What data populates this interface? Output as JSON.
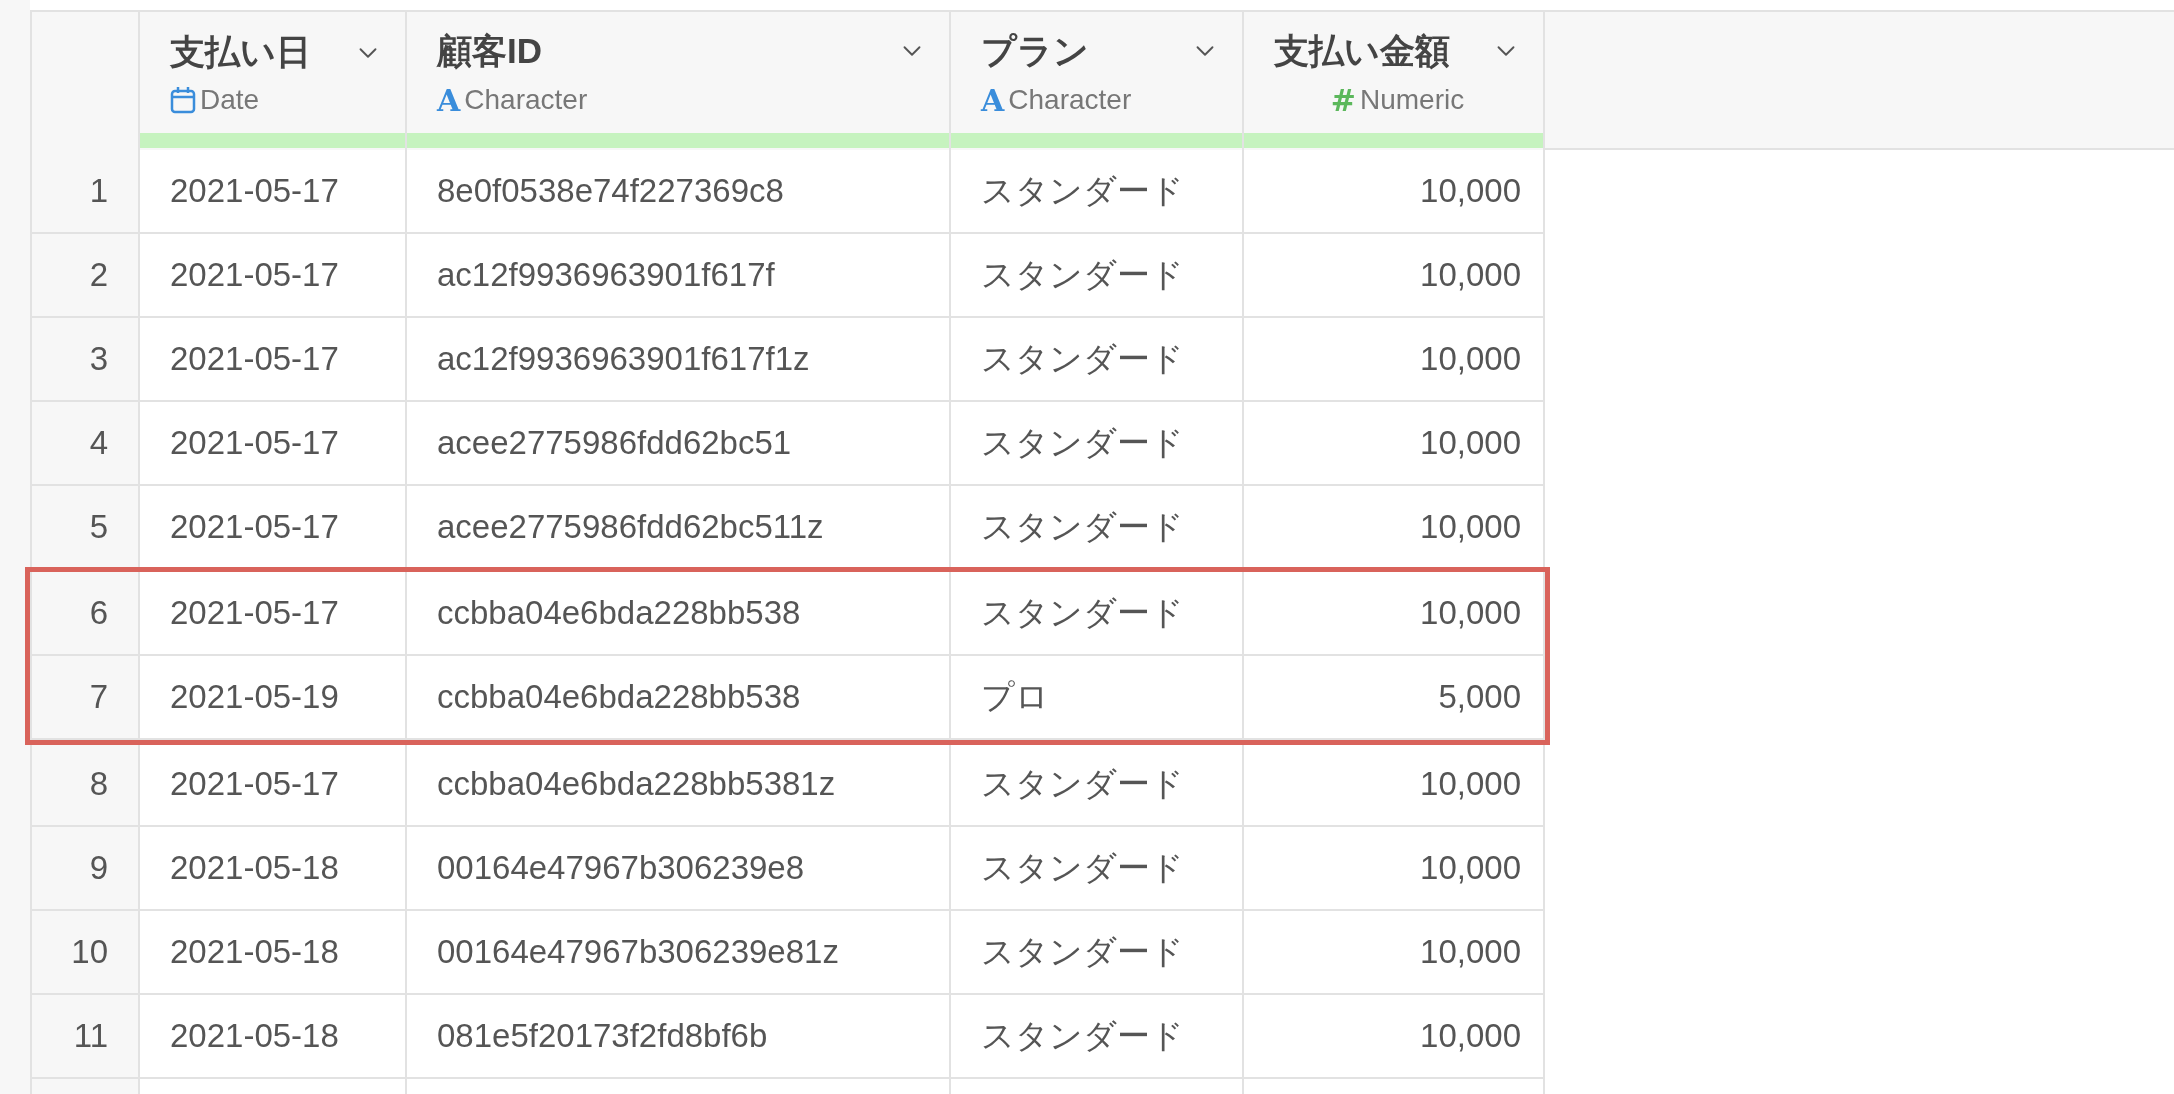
{
  "columns": [
    {
      "title": "支払い日",
      "kind": "date",
      "type_label": "Date"
    },
    {
      "title": "顧客ID",
      "kind": "character",
      "type_symbol": "A",
      "type_label": "Character"
    },
    {
      "title": "プラン",
      "kind": "character",
      "type_symbol": "A",
      "type_label": "Character"
    },
    {
      "title": "支払い金額",
      "kind": "numeric",
      "type_symbol": "#",
      "type_label": "Numeric"
    }
  ],
  "rows": [
    {
      "number": "1",
      "cells": [
        "2021-05-17",
        "8e0f0538e74f227369c8",
        "スタンダード",
        "10,000"
      ],
      "highlighted": false
    },
    {
      "number": "2",
      "cells": [
        "2021-05-17",
        "ac12f9936963901f617f",
        "スタンダード",
        "10,000"
      ],
      "highlighted": false
    },
    {
      "number": "3",
      "cells": [
        "2021-05-17",
        "ac12f9936963901f617f1z",
        "スタンダード",
        "10,000"
      ],
      "highlighted": false
    },
    {
      "number": "4",
      "cells": [
        "2021-05-17",
        "acee2775986fdd62bc51",
        "スタンダード",
        "10,000"
      ],
      "highlighted": false
    },
    {
      "number": "5",
      "cells": [
        "2021-05-17",
        "acee2775986fdd62bc511z",
        "スタンダード",
        "10,000"
      ],
      "highlighted": false
    },
    {
      "number": "6",
      "cells": [
        "2021-05-17",
        "ccbba04e6bda228bb538",
        "スタンダード",
        "10,000"
      ],
      "highlighted": true
    },
    {
      "number": "7",
      "cells": [
        "2021-05-19",
        "ccbba04e6bda228bb538",
        "プロ",
        "5,000"
      ],
      "highlighted": true
    },
    {
      "number": "8",
      "cells": [
        "2021-05-17",
        "ccbba04e6bda228bb5381z",
        "スタンダード",
        "10,000"
      ],
      "highlighted": false
    },
    {
      "number": "9",
      "cells": [
        "2021-05-18",
        "00164e47967b306239e8",
        "スタンダード",
        "10,000"
      ],
      "highlighted": false
    },
    {
      "number": "10",
      "cells": [
        "2021-05-18",
        "00164e47967b306239e81z",
        "スタンダード",
        "10,000"
      ],
      "highlighted": false
    },
    {
      "number": "11",
      "cells": [
        "2021-05-18",
        "081e5f20173f2fd8bf6b",
        "スタンダード",
        "10,000"
      ],
      "highlighted": false
    }
  ]
}
